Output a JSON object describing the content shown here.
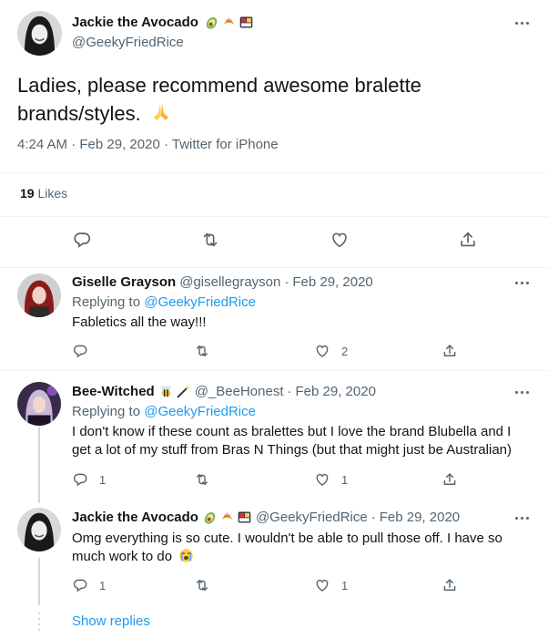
{
  "main_tweet": {
    "display_name": "Jackie the Avocado",
    "emojis": [
      "avocado",
      "croissant",
      "bento-box"
    ],
    "handle": "@GeekyFriedRice",
    "text": "Ladies, please recommend awesome bralette brands/styles.",
    "text_emoji": "folded-hands",
    "time": "4:24 AM",
    "date": "Feb 29, 2020",
    "source": "Twitter for iPhone",
    "likes_count": "19",
    "likes_label": "Likes"
  },
  "replies": [
    {
      "display_name": "Giselle Grayson",
      "handle": "@gisellegrayson",
      "date": "Feb 29, 2020",
      "replying_prefix": "Replying to",
      "replying_to": "@GeekyFriedRice",
      "text": "Fabletics all the way!!!",
      "like_count": "2"
    },
    {
      "display_name": "Bee-Witched",
      "emojis": [
        "bee",
        "magic-wand"
      ],
      "handle": "@_BeeHonest",
      "date": "Feb 29, 2020",
      "replying_prefix": "Replying to",
      "replying_to": "@GeekyFriedRice",
      "text": "I don't know if these count as bralettes but I love the brand Blubella and I get a lot of my stuff from Bras N Things (but that might just be Australian)",
      "reply_count": "1",
      "like_count": "1"
    },
    {
      "display_name": "Jackie the Avocado",
      "emojis": [
        "avocado",
        "croissant",
        "bento-box"
      ],
      "handle": "@GeekyFriedRice",
      "date": "Feb 29, 2020",
      "text": "Omg everything is so cute. I wouldn't be able to pull those off. I have so much work to do",
      "text_emoji": "loudly-crying-face",
      "reply_count": "1",
      "like_count": "1"
    }
  ],
  "show_replies": "Show replies",
  "separator": "·",
  "colors": {
    "link": "#1d9bf0",
    "muted": "#536471",
    "text": "#0f1419",
    "border": "#eff3f4"
  }
}
